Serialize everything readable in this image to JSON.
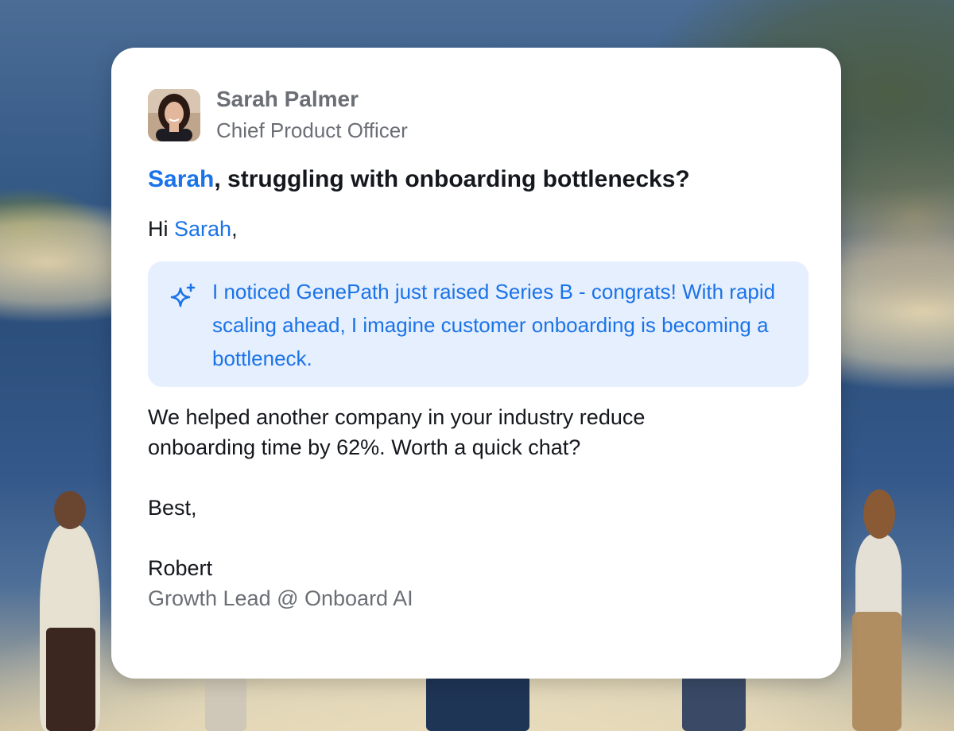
{
  "sender": {
    "name": "Sarah Palmer",
    "role": "Chief Product Officer",
    "avatar_icon": "person-photo-avatar"
  },
  "subject": {
    "highlight": "Sarah",
    "rest": ", struggling with onboarding bottlenecks?"
  },
  "greeting": {
    "prefix": "Hi ",
    "name": "Sarah",
    "suffix": ","
  },
  "insight": {
    "icon": "sparkles-icon",
    "text": "I noticed GenePath just raised Series B - congrats! With rapid scaling ahead, I imagine customer onboarding is becoming a bottleneck."
  },
  "body": "We helped another company in your industry reduce onboarding time by 62%. Worth a quick chat?",
  "signoff": "Best,",
  "signature": {
    "name": "Robert",
    "title": "Growth Lead @ Onboard AI"
  },
  "colors": {
    "accent": "#1a73e8",
    "insight_bg": "#e6effd",
    "text": "#14171c",
    "muted": "#6b6f75",
    "card": "#ffffff"
  }
}
